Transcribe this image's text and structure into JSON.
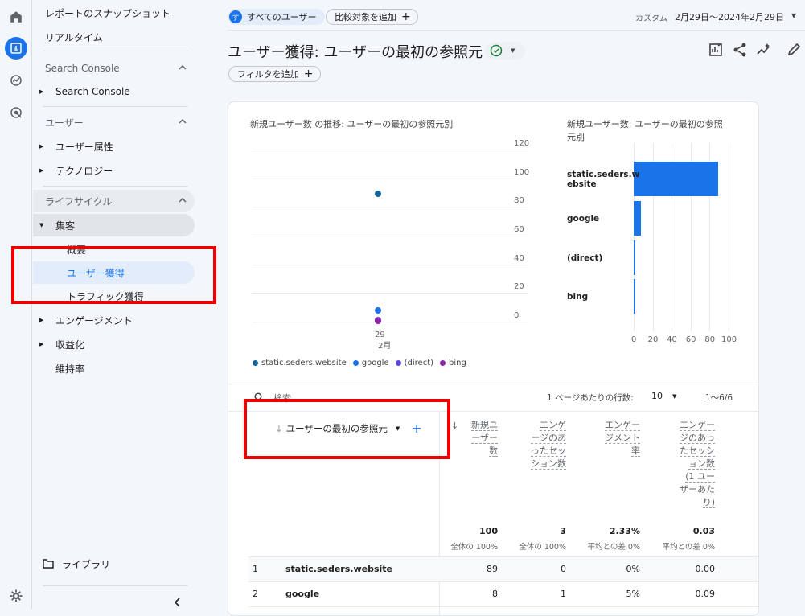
{
  "sidebar": {
    "items": [
      {
        "label": "レポートのスナップショット"
      },
      {
        "label": "リアルタイム"
      }
    ],
    "search_console": {
      "section": "Search Console",
      "item": "Search Console"
    },
    "user": {
      "section": "ユーザー",
      "items": [
        "ユーザー属性",
        "テクノロジー"
      ]
    },
    "lifecycle": {
      "section": "ライフサイクル",
      "acquisition": "集客",
      "sub": [
        "概要",
        "ユーザー獲得",
        "トラフィック獲得"
      ],
      "engagement": "エンゲージメント",
      "monetization": "収益化",
      "retention": "維持率"
    },
    "library": "ライブラリ"
  },
  "header": {
    "segment_badge": "す",
    "segment": "すべてのユーザー",
    "compare": "比較対象を追加",
    "date_label": "カスタム",
    "date_range": "2月29日〜2024年2月29日"
  },
  "page": {
    "title": "ユーザー獲得: ユーザーの最初の参照元",
    "filter": "フィルタを追加"
  },
  "line_chart": {
    "title": "新規ユーザー数 の推移: ユーザーの最初の参照元別",
    "x_tick": "29",
    "x_month": "2月"
  },
  "bar_chart": {
    "title_line1": "新規ユーザー数: ユーザーの最初の参照",
    "title_line2": "元別",
    "labels": [
      [
        "static.seders.w",
        "ebsite"
      ],
      [
        "google"
      ],
      [
        "(direct)"
      ],
      [
        "bing"
      ]
    ]
  },
  "chart_data": [
    {
      "type": "scatter",
      "title": "新規ユーザー数 の推移: ユーザーの最初の参照元別",
      "x": [
        "29 2月"
      ],
      "series": [
        {
          "name": "static.seders.website",
          "values": [
            89
          ],
          "color": "#12649c"
        },
        {
          "name": "google",
          "values": [
            8
          ],
          "color": "#1a73e8"
        },
        {
          "name": "(direct)",
          "values": [
            1
          ],
          "color": "#5b47e0"
        },
        {
          "name": "bing",
          "values": [
            1
          ],
          "color": "#8e24aa"
        }
      ],
      "y_ticks": [
        "0",
        "20",
        "40",
        "60",
        "80",
        "100",
        "120"
      ],
      "ylim": [
        0,
        120
      ],
      "grid": true,
      "legend": "bottom"
    },
    {
      "type": "bar",
      "title": "新規ユーザー数: ユーザーの最初の参照元別",
      "categories": [
        "static.seders.website",
        "google",
        "(direct)",
        "bing"
      ],
      "values": [
        89,
        8,
        2,
        1
      ],
      "x_ticks": [
        "0",
        "20",
        "40",
        "60",
        "80",
        "100"
      ],
      "xlim": [
        0,
        100
      ],
      "orientation": "horizontal",
      "color": "#1a73e8"
    }
  ],
  "table": {
    "search_placeholder": "検索",
    "rows_per_page_label": "1 ページあたりの行数:",
    "rows_per_page": "10",
    "pagination": "1〜6/6",
    "dimension_header": "ユーザーの最初の参照元",
    "columns": [
      {
        "label": [
          "新規ユ",
          "ーザー",
          "数"
        ],
        "total": "100",
        "sub": "全体の 100%"
      },
      {
        "label": [
          "エンゲ",
          "ージのあ",
          "ったセッ",
          "ション数"
        ],
        "total": "3",
        "sub": "全体の 100%"
      },
      {
        "label": [
          "エンゲー",
          "ジメント",
          "率"
        ],
        "total": "2.33%",
        "sub": "平均との差 0%"
      },
      {
        "label": [
          "エンゲー",
          "ジのあっ",
          "たセッシ",
          "ョン数",
          "(1 ユー",
          "ザーあた",
          "り)"
        ],
        "total": "0.03",
        "sub": "平均との差 0%"
      }
    ],
    "rows": [
      {
        "rank": "1",
        "source": "static.seders.website",
        "values": [
          "89",
          "0",
          "0%",
          "0.00"
        ]
      },
      {
        "rank": "2",
        "source": "google",
        "values": [
          "8",
          "1",
          "5%",
          "0.09"
        ]
      }
    ]
  },
  "colors": {
    "accent": "#1a73e8",
    "highlight": "#ee0000"
  }
}
